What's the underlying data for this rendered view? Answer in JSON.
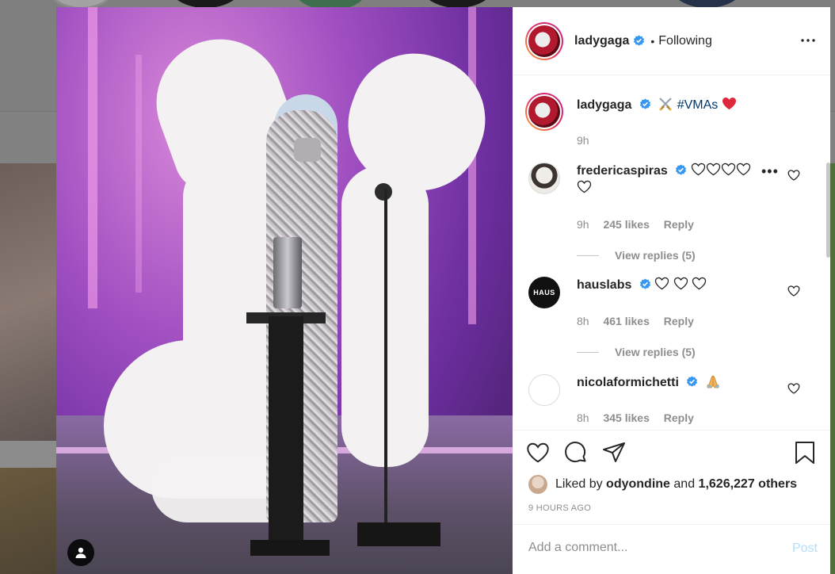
{
  "post": {
    "username": "ladygaga",
    "follow_separator": "•",
    "follow_status": "Following",
    "caption": {
      "username": "ladygaga",
      "hashtag": "#VMAs",
      "time": "9h"
    }
  },
  "comments": [
    {
      "username": "fredericaspiras",
      "time": "9h",
      "likes": "245 likes",
      "reply": "Reply",
      "view_replies": "View replies (5)"
    },
    {
      "username": "hauslabs",
      "avatar_text": "HAUS",
      "time": "8h",
      "likes": "461 likes",
      "reply": "Reply",
      "view_replies": "View replies (5)"
    },
    {
      "username": "nicolaformichetti",
      "time": "8h",
      "likes": "345 likes",
      "reply": "Reply"
    }
  ],
  "actions": {
    "liked_by_prefix": "Liked by",
    "liked_by_user": "odyondine",
    "liked_by_and": "and",
    "liked_by_count": "1,626,227 others",
    "timestamp": "9 HOURS AGO"
  },
  "comment_box": {
    "placeholder": "Add a comment...",
    "post_label": "Post"
  },
  "colors": {
    "verified": "#3897f0",
    "heart_red": "#ed4956",
    "post_disabled": "#b2dffc"
  }
}
